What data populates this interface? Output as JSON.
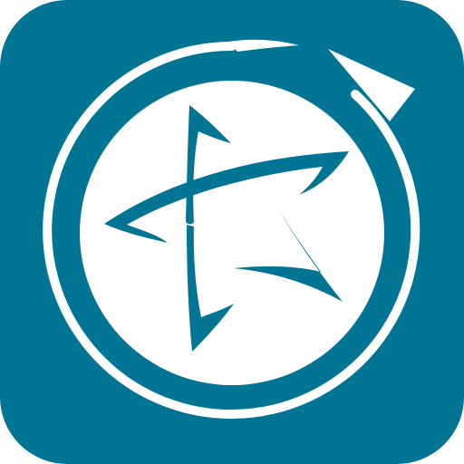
{
  "icon": {
    "name": "star-compass-app-icon",
    "colors": {
      "tile": "#037594",
      "emblem": "#ffffff",
      "page_background": "#ffffff"
    }
  }
}
